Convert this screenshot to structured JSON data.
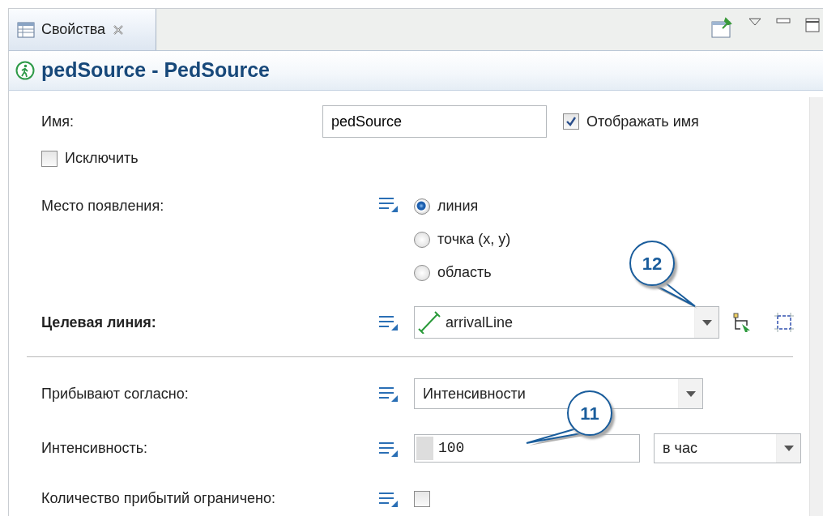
{
  "tab": {
    "label": "Свойства",
    "selected": true
  },
  "header": {
    "title": "pedSource - PedSource"
  },
  "rows": [
    {
      "kind": "text",
      "label": "Имя:",
      "value": "pedSource",
      "option": {
        "label": "Отображать имя",
        "checked": true
      }
    },
    {
      "kind": "checkbox",
      "label": "Исключить",
      "checked": false
    },
    {
      "kind": "radio",
      "label": "Место появления:",
      "options": [
        {
          "label": "линия",
          "selected": true
        },
        {
          "label": "точка (x, y)",
          "selected": false
        },
        {
          "label": "область",
          "selected": false
        }
      ]
    },
    {
      "kind": "target",
      "label": "Целевая линия:",
      "bold": true,
      "value": "arrivalLine"
    },
    {
      "kind": "divider"
    },
    {
      "kind": "combo",
      "label": "Прибывают согласно:",
      "bold": false,
      "value": "Интенсивности"
    },
    {
      "kind": "number",
      "label": "Интенсивность:",
      "value": "100",
      "unit": "в час"
    },
    {
      "kind": "check",
      "label": "Количество прибытий ограничено:",
      "checked": false
    }
  ],
  "callouts": [
    {
      "number": "12"
    },
    {
      "number": "11"
    }
  ]
}
